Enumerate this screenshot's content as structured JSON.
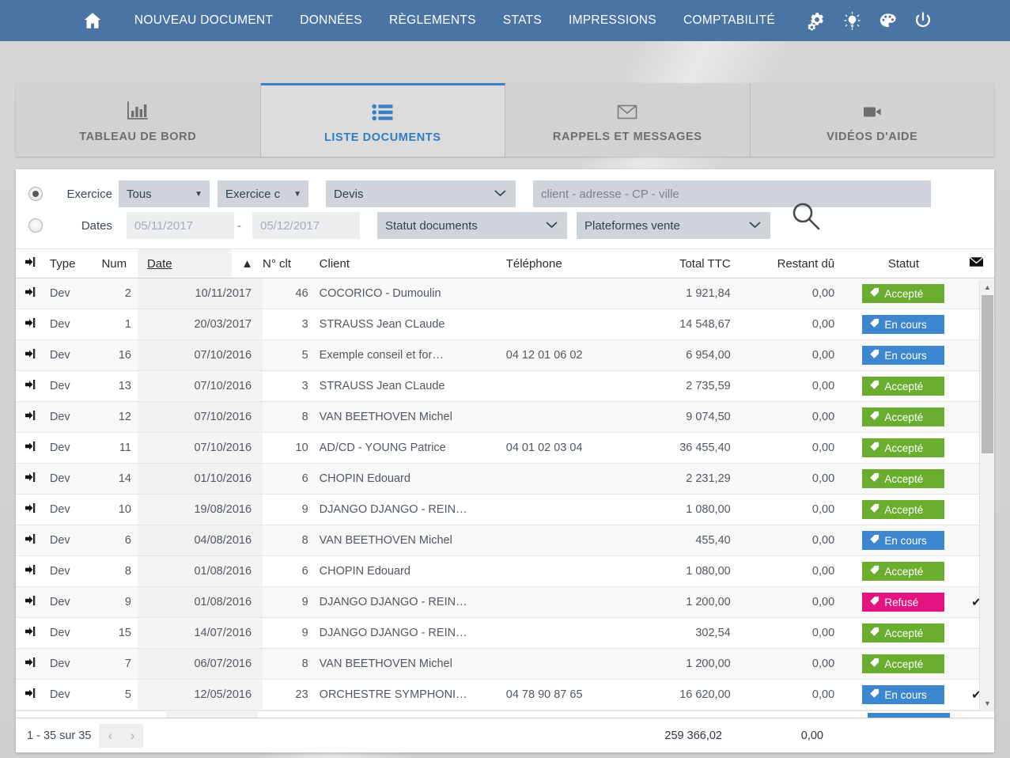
{
  "topnav": {
    "home_icon": "home-icon",
    "items": [
      {
        "label": "NOUVEAU DOCUMENT"
      },
      {
        "label": "DONNÉES"
      },
      {
        "label": "RÈGLEMENTS"
      },
      {
        "label": "STATS"
      },
      {
        "label": "IMPRESSIONS"
      },
      {
        "label": "COMPTABILITÉ"
      }
    ],
    "icons": [
      {
        "name": "gears-icon"
      },
      {
        "name": "lightbulb-icon"
      },
      {
        "name": "palette-icon"
      },
      {
        "name": "power-icon"
      }
    ],
    "bg_color": "#4a74a4"
  },
  "tabs": [
    {
      "label": "TABLEAU DE BORD",
      "icon": "bar-chart-icon",
      "active": false
    },
    {
      "label": "LISTE DOCUMENTS",
      "icon": "list-icon",
      "active": true
    },
    {
      "label": "RAPPELS ET MESSAGES",
      "icon": "envelope-icon",
      "active": false
    },
    {
      "label": "VIDÉOS D'AIDE",
      "icon": "video-camera-icon",
      "active": false
    }
  ],
  "filters": {
    "exercice_radio_label": "Exercice",
    "exercice_radio_checked": true,
    "dates_radio_label": "Dates",
    "dates_radio_checked": false,
    "exercice_select_value": "Tous",
    "exercice_c_select_value": "Exercice c",
    "doc_type_select_value": "Devis",
    "statut_select_value": "Statut documents",
    "plateformes_select_value": "Plateformes vente",
    "date_from_placeholder": "05/11/2017",
    "date_to_placeholder": "05/12/2017",
    "date_separator": "-",
    "client_search_placeholder": "client - adresse - CP - ville",
    "client_search_value": "",
    "search_icon": "magnifier-icon"
  },
  "table": {
    "columns": [
      {
        "key": "arrow",
        "label": "",
        "icon": "open-document-icon"
      },
      {
        "key": "type",
        "label": "Type"
      },
      {
        "key": "num",
        "label": "Num"
      },
      {
        "key": "date",
        "label": "Date",
        "sorted": true,
        "sort_dir": "asc",
        "sort_indicator": "▲"
      },
      {
        "key": "nclt",
        "label": "N° clt"
      },
      {
        "key": "client",
        "label": "Client"
      },
      {
        "key": "tel",
        "label": "Téléphone"
      },
      {
        "key": "total",
        "label": "Total TTC"
      },
      {
        "key": "restant",
        "label": "Restant dû"
      },
      {
        "key": "statut",
        "label": "Statut"
      },
      {
        "key": "mail",
        "label": "",
        "icon": "envelope-icon"
      }
    ],
    "rows": [
      {
        "type": "Dev",
        "num": "2",
        "date": "10/11/2017",
        "nclt": "46",
        "client": "COCORICO - Dumoulin",
        "tel": "",
        "total": "1 921,84",
        "restant": "0,00",
        "statut": "Accepté",
        "statut_color": "green",
        "mail": false
      },
      {
        "type": "Dev",
        "num": "1",
        "date": "20/03/2017",
        "nclt": "3",
        "client": "STRAUSS Jean CLaude",
        "tel": "",
        "total": "14 548,67",
        "restant": "0,00",
        "statut": "En cours",
        "statut_color": "blue",
        "mail": false
      },
      {
        "type": "Dev",
        "num": "16",
        "date": "07/10/2016",
        "nclt": "5",
        "client": "Exemple conseil et for…",
        "tel": "04 12 01 06 02",
        "total": "6 954,00",
        "restant": "0,00",
        "statut": "En cours",
        "statut_color": "blue",
        "mail": false
      },
      {
        "type": "Dev",
        "num": "13",
        "date": "07/10/2016",
        "nclt": "3",
        "client": "STRAUSS Jean CLaude",
        "tel": "",
        "total": "2 735,59",
        "restant": "0,00",
        "statut": "Accepté",
        "statut_color": "green",
        "mail": false
      },
      {
        "type": "Dev",
        "num": "12",
        "date": "07/10/2016",
        "nclt": "8",
        "client": "VAN BEETHOVEN Michel",
        "tel": "",
        "total": "9 074,50",
        "restant": "0,00",
        "statut": "Accepté",
        "statut_color": "green",
        "mail": false
      },
      {
        "type": "Dev",
        "num": "11",
        "date": "07/10/2016",
        "nclt": "10",
        "client": "AD/CD - YOUNG Patrice",
        "tel": "04 01 02 03 04",
        "total": "36 455,40",
        "restant": "0,00",
        "statut": "Accepté",
        "statut_color": "green",
        "mail": false
      },
      {
        "type": "Dev",
        "num": "14",
        "date": "01/10/2016",
        "nclt": "6",
        "client": "CHOPIN Edouard",
        "tel": "",
        "total": "2 231,29",
        "restant": "0,00",
        "statut": "Accepté",
        "statut_color": "green",
        "mail": false
      },
      {
        "type": "Dev",
        "num": "10",
        "date": "19/08/2016",
        "nclt": "9",
        "client": "DJANGO DJANGO - REIN…",
        "tel": "",
        "total": "1 080,00",
        "restant": "0,00",
        "statut": "Accepté",
        "statut_color": "green",
        "mail": false
      },
      {
        "type": "Dev",
        "num": "6",
        "date": "04/08/2016",
        "nclt": "8",
        "client": "VAN BEETHOVEN Michel",
        "tel": "",
        "total": "455,40",
        "restant": "0,00",
        "statut": "En cours",
        "statut_color": "blue",
        "mail": false
      },
      {
        "type": "Dev",
        "num": "8",
        "date": "01/08/2016",
        "nclt": "6",
        "client": "CHOPIN Edouard",
        "tel": "",
        "total": "1 080,00",
        "restant": "0,00",
        "statut": "Accepté",
        "statut_color": "green",
        "mail": false
      },
      {
        "type": "Dev",
        "num": "9",
        "date": "01/08/2016",
        "nclt": "9",
        "client": "DJANGO DJANGO - REIN…",
        "tel": "",
        "total": "1 200,00",
        "restant": "0,00",
        "statut": "Refusé",
        "statut_color": "pink",
        "mail": true
      },
      {
        "type": "Dev",
        "num": "15",
        "date": "14/07/2016",
        "nclt": "9",
        "client": "DJANGO DJANGO - REIN…",
        "tel": "",
        "total": "302,54",
        "restant": "0,00",
        "statut": "Accepté",
        "statut_color": "green",
        "mail": false
      },
      {
        "type": "Dev",
        "num": "7",
        "date": "06/07/2016",
        "nclt": "8",
        "client": "VAN BEETHOVEN Michel",
        "tel": "",
        "total": "1 200,00",
        "restant": "0,00",
        "statut": "Accepté",
        "statut_color": "green",
        "mail": false
      },
      {
        "type": "Dev",
        "num": "5",
        "date": "12/05/2016",
        "nclt": "23",
        "client": "ORCHESTRE SYMPHONI…",
        "tel": "04 78 90 87 65",
        "total": "16 620,00",
        "restant": "0,00",
        "statut": "En cours",
        "statut_color": "blue",
        "mail": true
      }
    ],
    "scrollbar": {
      "up_arrow": "▲",
      "down_arrow": "▼"
    }
  },
  "footer": {
    "pagination_text": "1 - 35 sur 35",
    "prev_label": "‹",
    "next_label": "›",
    "total_ttc": "259 366,02",
    "restant_du": "0,00"
  },
  "colors": {
    "nav_blue": "#4a74a4",
    "accent_blue": "#3b7fc4",
    "badge_green": "#6aad2f",
    "badge_blue": "#3d87ce",
    "badge_pink": "#e5137f"
  }
}
